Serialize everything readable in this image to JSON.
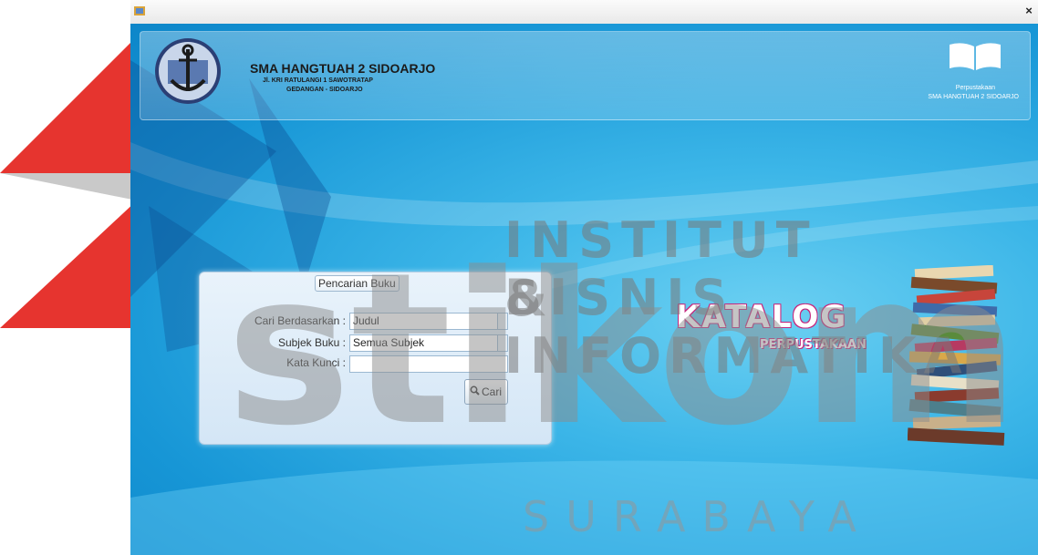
{
  "window": {
    "close_glyph": "×"
  },
  "header": {
    "school_name": "SMA HANGTUAH 2 SIDOARJO",
    "address_line1": "Jl. KRI RATULANGI 1 SAWOTRATAP",
    "address_line2": "GEDANGAN - SIDOARJO",
    "library_label": "Perpustakaan",
    "library_school": "SMA HANGTUAH 2 SIDOARJO"
  },
  "search": {
    "title": "Pencarian Buku",
    "search_by_label": "Cari Berdasarkan :",
    "search_by_value": "Judul",
    "subject_label": "Subjek Buku :",
    "subject_value": "Semua Subjek",
    "keyword_label": "Kata Kunci :",
    "keyword_value": "",
    "button_label": "Cari"
  },
  "banner": {
    "title": "KATALOG",
    "subtitle": "PERPUSTAKAAN"
  },
  "watermark": {
    "line1": "INSTITUT BISNIS",
    "line2": "& INFORMATIKA",
    "brand": "stikom",
    "city": "SURABAYA"
  },
  "colors": {
    "window_blue": "#1796d6",
    "watermark_red": "#e0242c",
    "watermark_gray": "#8a8a8a",
    "katalog_pink": "#c6277d"
  }
}
